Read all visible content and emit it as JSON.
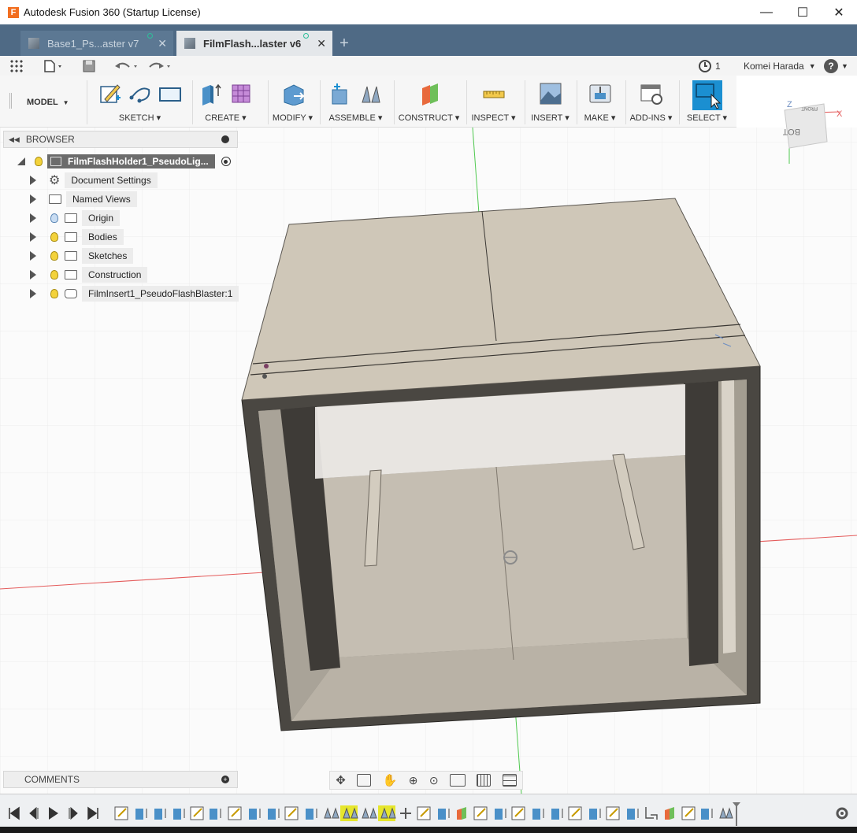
{
  "window": {
    "title": "Autodesk Fusion 360 (Startup License)",
    "app_icon": "F",
    "minimize": "—",
    "maximize": "☐",
    "close": "✕"
  },
  "tabs": [
    {
      "label": "Base1_Ps...aster v7",
      "active": false,
      "close": "✕"
    },
    {
      "label": "FilmFlash...laster v6",
      "active": true,
      "close": "✕"
    }
  ],
  "tab_add": "+",
  "quick_access": {
    "jobs_count": "1",
    "user": "Komei Harada",
    "help": "?"
  },
  "ribbon": {
    "workspace": "MODEL",
    "groups": [
      {
        "label": "SKETCH"
      },
      {
        "label": "CREATE"
      },
      {
        "label": "MODIFY"
      },
      {
        "label": "ASSEMBLE"
      },
      {
        "label": "CONSTRUCT"
      },
      {
        "label": "INSPECT"
      },
      {
        "label": "INSERT"
      },
      {
        "label": "MAKE"
      },
      {
        "label": "ADD-INS"
      },
      {
        "label": "SELECT"
      }
    ]
  },
  "browser": {
    "title": "BROWSER",
    "root": "FilmFlashHolder1_PseudoLig...",
    "items": [
      {
        "label": "Document Settings"
      },
      {
        "label": "Named Views"
      },
      {
        "label": "Origin"
      },
      {
        "label": "Bodies"
      },
      {
        "label": "Sketches"
      },
      {
        "label": "Construction"
      },
      {
        "label": "FilmInsert1_PseudoFlashBlaster:1"
      }
    ]
  },
  "comments": {
    "title": "COMMENTS"
  },
  "viewcube": {
    "face_label": "BOTTOM",
    "top_label": "FRONT",
    "axis_x": "X",
    "axis_z": "Z"
  },
  "colors": {
    "tab_bar": "#4f6a85",
    "select_active": "#1b8fd1",
    "model_top": "#cfc7b8",
    "model_wall": "#4b4843",
    "axis_red": "#e45b5b",
    "axis_green": "#4fc94f"
  }
}
